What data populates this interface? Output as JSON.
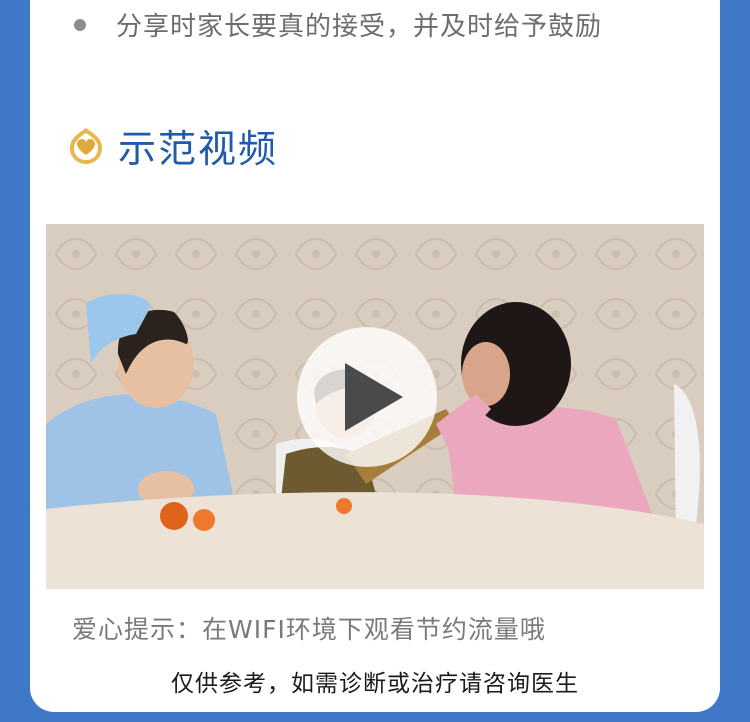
{
  "bullet": {
    "text": "分享时家长要真的接受，并及时给予鼓励"
  },
  "section": {
    "title": "示范视频",
    "icon": "gold-heart-icon"
  },
  "video": {
    "play_icon": "play-icon"
  },
  "tip": {
    "text": "爱心提示：在WIFI环境下观看节约流量哦"
  },
  "disclaimer": {
    "text": "仅供参考，如需诊断或治疗请咨询医生"
  },
  "colors": {
    "page_background": "#3f78c6",
    "card": "#ffffff",
    "title_blue": "#1f5ba8",
    "icon_gold": "#e0b14a"
  }
}
